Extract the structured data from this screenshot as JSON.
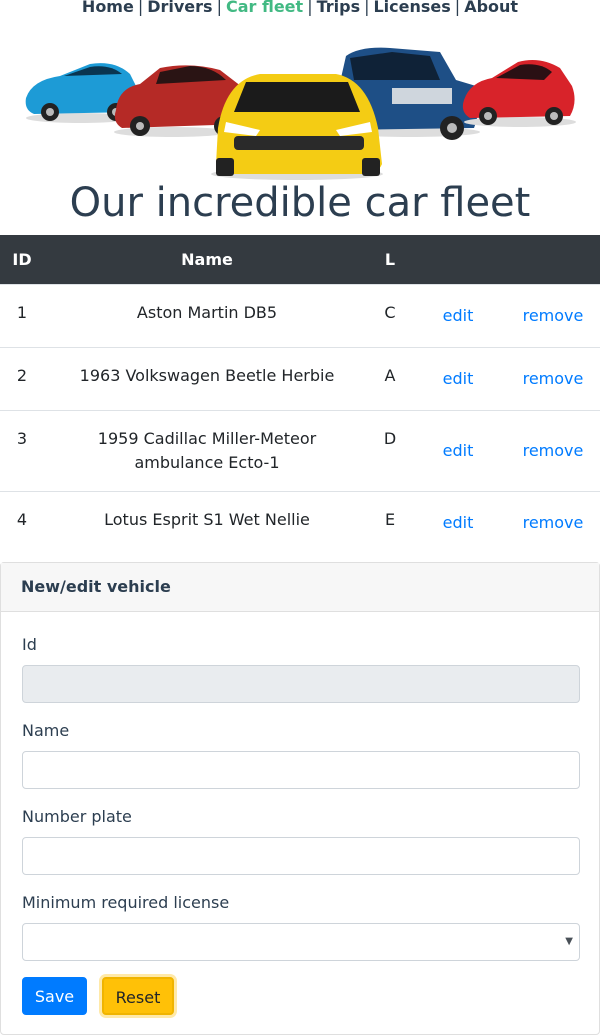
{
  "nav": {
    "items": [
      "Home",
      "Drivers",
      "Car fleet",
      "Trips",
      "Licenses",
      "About"
    ],
    "separator": "|",
    "active": "Car fleet"
  },
  "page": {
    "title": "Our incredible car fleet"
  },
  "colors": {
    "nav_active": "#42b983",
    "link": "#007bff",
    "primary": "#007bff",
    "warning": "#ffc107",
    "table_header": "#343a40"
  },
  "table": {
    "headers": [
      "ID",
      "Name",
      "L",
      "",
      ""
    ],
    "rows": [
      {
        "id": "1",
        "name": "Aston Martin DB5",
        "license": "C",
        "edit": "edit",
        "remove": "remove"
      },
      {
        "id": "2",
        "name": "1963 Volkswagen Beetle Herbie",
        "license": "A",
        "edit": "edit",
        "remove": "remove"
      },
      {
        "id": "3",
        "name": "1959 Cadillac Miller-Meteor ambulance Ecto-1",
        "license": "D",
        "edit": "edit",
        "remove": "remove"
      },
      {
        "id": "4",
        "name": "Lotus Esprit S1 Wet Nellie",
        "license": "E",
        "edit": "edit",
        "remove": "remove"
      }
    ]
  },
  "form": {
    "header": "New/edit vehicle",
    "id_label": "Id",
    "id_value": "",
    "name_label": "Name",
    "name_value": "",
    "plate_label": "Number plate",
    "plate_value": "",
    "license_label": "Minimum required license",
    "license_value": "",
    "save_label": "Save",
    "reset_label": "Reset"
  },
  "hero": {
    "icon": "car-fleet-image"
  }
}
